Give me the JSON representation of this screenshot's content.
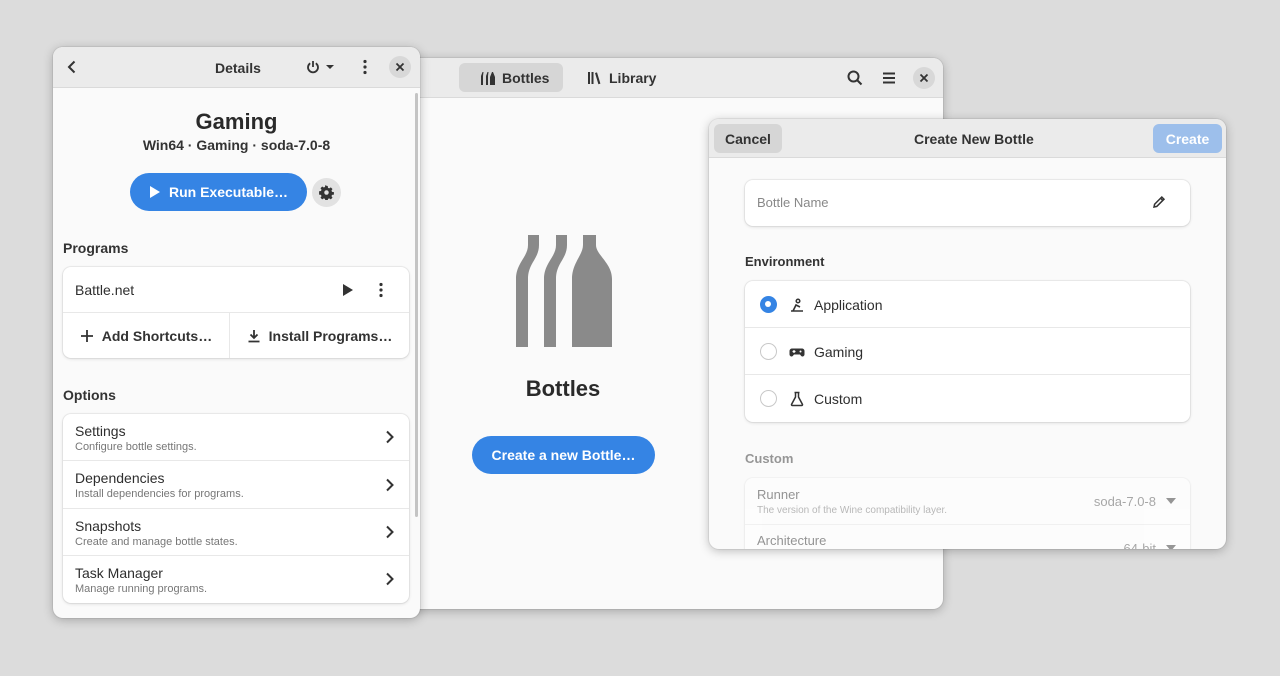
{
  "colors": {
    "accent": "#3584e4",
    "accent_disabled": "#9dbfeb",
    "window_bg": "#fafafa",
    "headerbar": "#ebebeb"
  },
  "main_window": {
    "tabs": [
      {
        "label": "Bottles",
        "icon": "bottles-icon",
        "active": true
      },
      {
        "label": "Library",
        "icon": "library-icon",
        "active": false
      }
    ],
    "empty_state": {
      "icon": "bottles-logo-icon",
      "title": "Bottles",
      "button": "Create a new Bottle…"
    }
  },
  "details_window": {
    "header_title": "Details",
    "bottle_name": "Gaming",
    "bottle_meta": "Win64 · Gaming · soda-7.0-8",
    "run_button": "Run Executable…",
    "programs_label": "Programs",
    "programs": [
      {
        "name": "Battle.net"
      }
    ],
    "add_shortcuts": "Add Shortcuts…",
    "install_programs": "Install Programs…",
    "options_label": "Options",
    "options": [
      {
        "title": "Settings",
        "subtitle": "Configure bottle settings."
      },
      {
        "title": "Dependencies",
        "subtitle": "Install dependencies for programs."
      },
      {
        "title": "Snapshots",
        "subtitle": "Create and manage bottle states."
      },
      {
        "title": "Task Manager",
        "subtitle": "Manage running programs."
      }
    ]
  },
  "dialog": {
    "title": "Create New Bottle",
    "cancel": "Cancel",
    "create": "Create",
    "name_placeholder": "Bottle Name",
    "environment_label": "Environment",
    "environments": [
      {
        "label": "Application",
        "icon": "application-icon",
        "selected": true
      },
      {
        "label": "Gaming",
        "icon": "gamepad-icon",
        "selected": false
      },
      {
        "label": "Custom",
        "icon": "flask-icon",
        "selected": false
      }
    ],
    "custom_label": "Custom",
    "runner": {
      "title": "Runner",
      "subtitle": "The version of the Wine compatibility layer.",
      "value": "soda-7.0-8"
    },
    "architecture": {
      "title": "Architecture",
      "value": "64-bit"
    }
  }
}
